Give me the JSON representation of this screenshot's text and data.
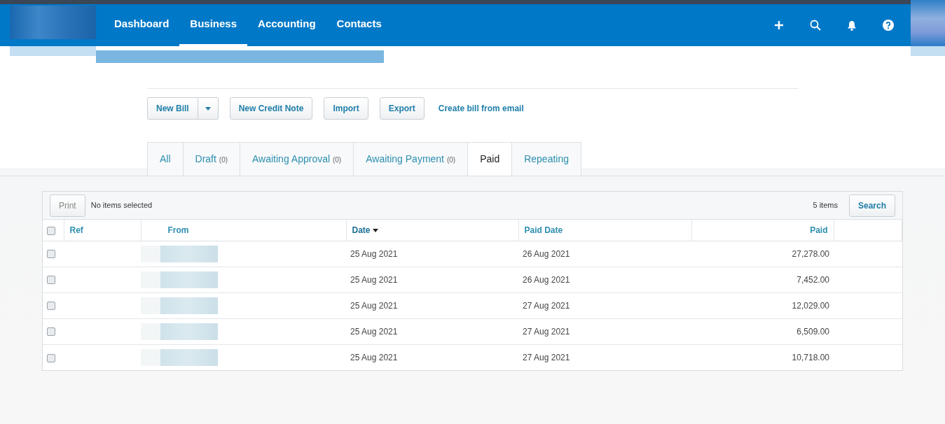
{
  "nav": {
    "items": [
      {
        "label": "Dashboard",
        "selected": false
      },
      {
        "label": "Business",
        "selected": true
      },
      {
        "label": "Accounting",
        "selected": false
      },
      {
        "label": "Contacts",
        "selected": false
      }
    ]
  },
  "actions": {
    "new_bill": "New Bill",
    "buttons": [
      "New Credit Note",
      "Import",
      "Export"
    ],
    "link": "Create bill from email"
  },
  "tabs": [
    {
      "label": "All",
      "selected": false
    },
    {
      "label": "Draft",
      "count": "(0)",
      "selected": false
    },
    {
      "label": "Awaiting Approval",
      "count": "(0)",
      "selected": false
    },
    {
      "label": "Awaiting Payment",
      "count": "(0)",
      "selected": false
    },
    {
      "label": "Paid",
      "selected": true
    },
    {
      "label": "Repeating",
      "selected": false
    }
  ],
  "toolbar": {
    "print": "Print",
    "selection": "No items selected",
    "count": "5 items",
    "search": "Search"
  },
  "table": {
    "select_all": {
      "checked": false
    },
    "columns": [
      {
        "label": "Ref",
        "sorted": false
      },
      {
        "label": "From",
        "sorted": false
      },
      {
        "label": "Date",
        "sorted": true
      },
      {
        "label": "Paid Date",
        "sorted": false
      },
      {
        "label": "Paid",
        "sorted": false
      }
    ],
    "rows": [
      {
        "checked": false,
        "date": "25 Aug 2021",
        "paid_date": "26 Aug 2021",
        "paid": "27,278.00"
      },
      {
        "checked": false,
        "date": "25 Aug 2021",
        "paid_date": "26 Aug 2021",
        "paid": "7,452.00"
      },
      {
        "checked": false,
        "date": "25 Aug 2021",
        "paid_date": "27 Aug 2021",
        "paid": "12,029.00"
      },
      {
        "checked": false,
        "date": "25 Aug 2021",
        "paid_date": "27 Aug 2021",
        "paid": "6,509.00"
      },
      {
        "checked": false,
        "date": "25 Aug 2021",
        "paid_date": "27 Aug 2021",
        "paid": "10,718.00"
      }
    ]
  }
}
